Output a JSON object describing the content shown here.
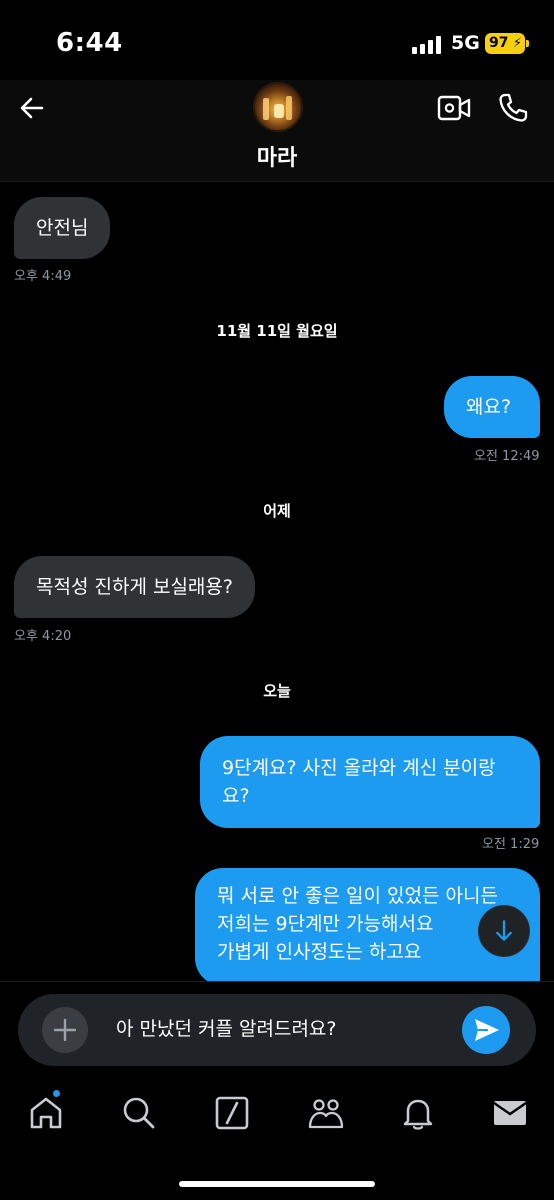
{
  "status_bar": {
    "time": "6:44",
    "network": "5G",
    "battery": "97"
  },
  "header": {
    "name": "마라"
  },
  "messages": [
    {
      "dir": "in",
      "text": "안전님",
      "time": "오후 4:49"
    },
    {
      "divider": "11월 11일 월요일"
    },
    {
      "dir": "out",
      "text": "왜요?",
      "time": "오전 12:49"
    },
    {
      "divider": "어제"
    },
    {
      "dir": "in",
      "text": "목적성 진하게 보실래용?",
      "time": "오후 4:20"
    },
    {
      "divider": "오늘"
    },
    {
      "dir": "out",
      "lines": [
        "9단계요? 사진 올라와 계신 분이랑",
        "요?"
      ],
      "time": "오전 1:29"
    },
    {
      "dir": "out",
      "lines": [
        "뭐 서로 안 좋은 일이 있었든 아니든",
        "저희는 9단계만 가능해서요",
        "가볍게 인사정도는 하고요"
      ]
    }
  ],
  "composer": {
    "draft": "아 만났던 커플 알려드려요?"
  },
  "icons": {
    "back": "arrow-left-icon",
    "video": "video-camera-icon",
    "call": "phone-icon",
    "scroll": "arrow-down-icon",
    "add": "plus-icon",
    "send": "send-icon",
    "tabs": [
      "home-icon",
      "search-icon",
      "grok-icon",
      "communities-icon",
      "notifications-icon",
      "messages-icon"
    ]
  },
  "colors": {
    "accent": "#1d9bf0",
    "incoming": "#2f3336",
    "battery": "#f5d00c"
  }
}
